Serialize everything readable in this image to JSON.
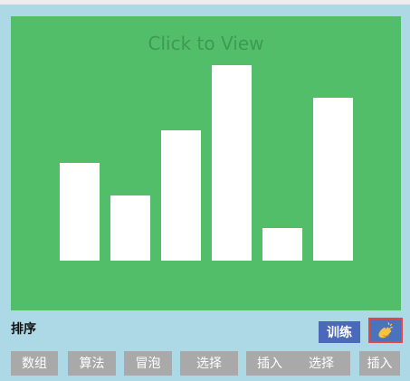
{
  "card": {
    "overlay_text": "Click to View",
    "background_color": "#52be6a",
    "bar_color": "#ffffff"
  },
  "chart_data": {
    "type": "bar",
    "values": [
      108,
      72,
      144,
      216,
      36,
      180
    ],
    "ylim": [
      0,
      216
    ],
    "bar_color": "#ffffff"
  },
  "bottom": {
    "title": "排序",
    "train_label": "训练",
    "clap_icon": "clap-icon"
  },
  "tags": [
    {
      "label": "数组"
    },
    {
      "label": "算法"
    },
    {
      "label": "冒泡"
    },
    {
      "label": "选择"
    },
    {
      "label": "插入"
    },
    {
      "label": "选择"
    },
    {
      "label": "插入"
    }
  ]
}
